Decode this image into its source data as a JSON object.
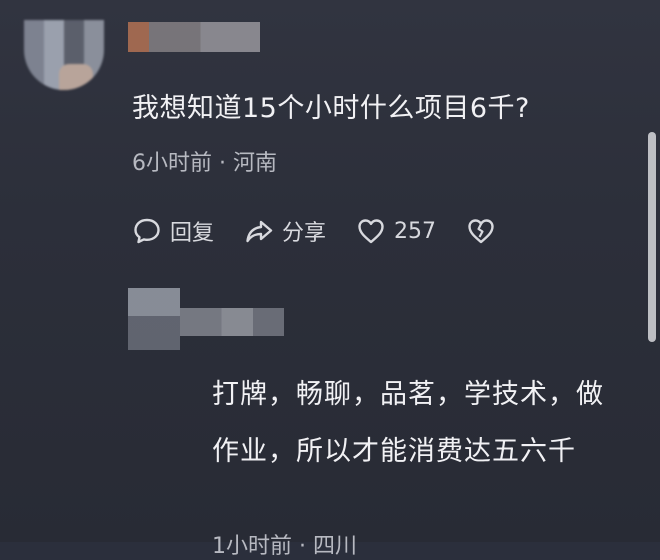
{
  "comment": {
    "text": "我想知道15个小时什么项目6千?",
    "meta": "6小时前 · 河南",
    "actions": {
      "reply_label": "回复",
      "share_label": "分享",
      "like_count": "257"
    }
  },
  "reply": {
    "text": "打牌，畅聊，品茗，学技术，做作业，所以才能消费达五六千",
    "meta": "1小时前 · 四川"
  },
  "icons": [
    "comment-bubble-icon",
    "share-arrow-icon",
    "heart-icon",
    "broken-heart-icon"
  ]
}
